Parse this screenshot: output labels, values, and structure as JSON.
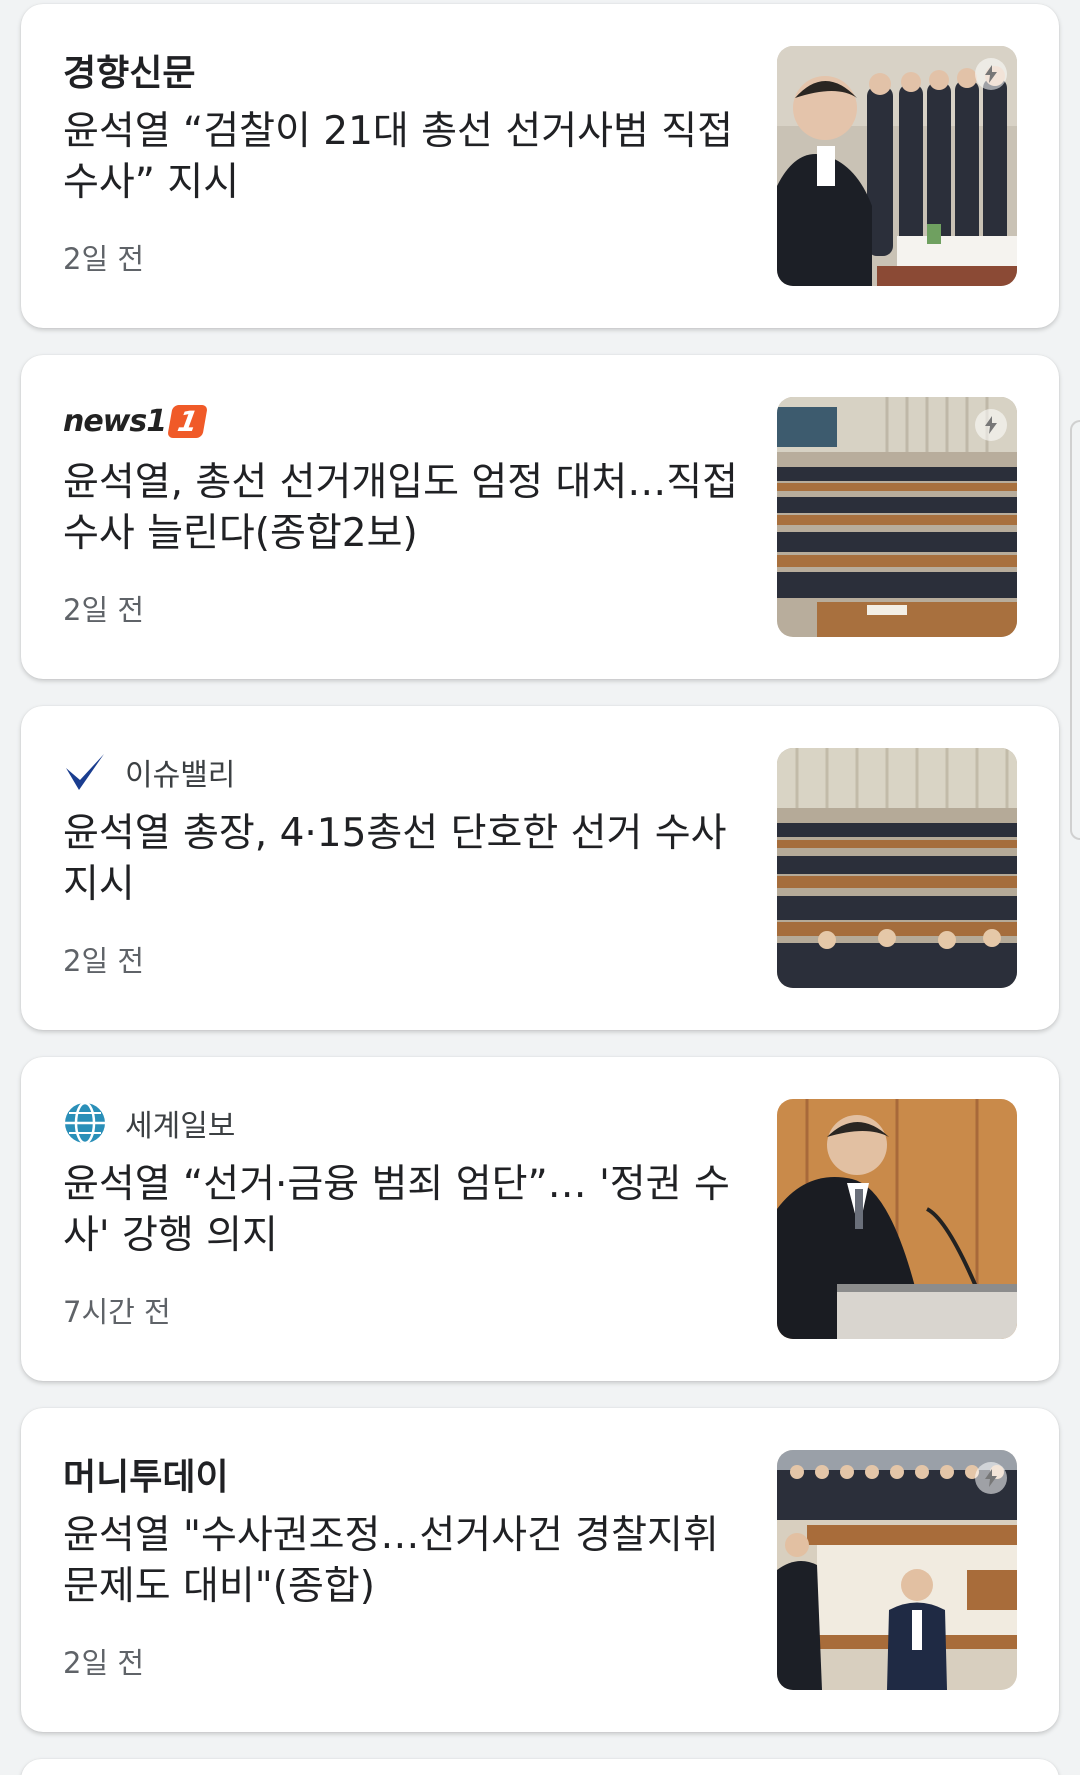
{
  "articles": [
    {
      "source": "경향신문",
      "headline": "윤석열 “검찰이 21대 총선 선거사범 직접수사” 지시",
      "time": "2일 전",
      "logo_icon": "none",
      "thumbnail": "prosecutor-meeting-photo"
    },
    {
      "source": "news1",
      "source_badge": "1",
      "headline": "윤석열, 총선 선거개입도 엄정 대처…직접수사 늘린다(종합2보)",
      "time": "2일 전",
      "logo_icon": "news1-logo",
      "thumbnail": "conference-hall-photo"
    },
    {
      "source": "이슈밸리",
      "headline": "윤석열 총장, 4·15총선 단호한 선거 수사 지시",
      "time": "2일 전",
      "logo_icon": "checkmark-icon",
      "thumbnail": "conference-hall-photo"
    },
    {
      "source": "세계일보",
      "headline": "윤석열 “선거·금융 범죄 엄단”… '정권 수사' 강행 의지",
      "time": "7시간 전",
      "logo_icon": "globe-icon",
      "thumbnail": "speaker-podium-photo"
    },
    {
      "source": "머니투데이",
      "headline": "윤석열 \"수사권조정…선거사건 경찰지휘 문제도 대비\"(종합)",
      "time": "2일 전",
      "logo_icon": "none",
      "thumbnail": "conference-salute-photo"
    }
  ],
  "colors": {
    "background": "#f1f3f4",
    "card": "#ffffff",
    "headline": "#202124",
    "meta": "#5f6368",
    "news1_accent": "#f05a28",
    "checkmark": "#1a3d8f"
  }
}
